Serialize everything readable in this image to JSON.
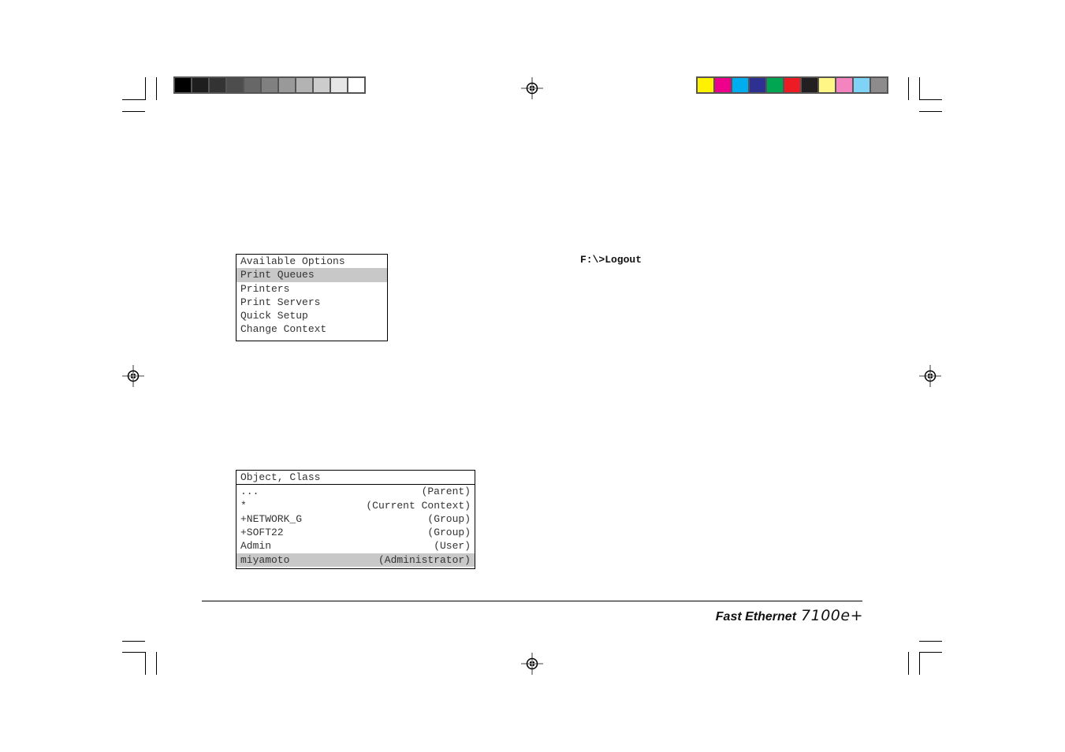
{
  "swatches": {
    "grayscale": [
      "#000000",
      "#1e1e1e",
      "#333333",
      "#4d4d4d",
      "#676767",
      "#808080",
      "#999999",
      "#b3b3b3",
      "#cccccc",
      "#e6e6e6",
      "#ffffff"
    ],
    "color": [
      "#fff200",
      "#ec008c",
      "#00aeef",
      "#2e3192",
      "#00a651",
      "#ed1c24",
      "#231f20",
      "#fff685",
      "#f384c0",
      "#7fd3f7",
      "#8d8b8c"
    ]
  },
  "options_menu": {
    "title": "Available Options",
    "items": [
      {
        "label": "Print Queues",
        "selected": true
      },
      {
        "label": "Printers",
        "selected": false
      },
      {
        "label": "Print Servers",
        "selected": false
      },
      {
        "label": "Quick Setup",
        "selected": false
      },
      {
        "label": "Change Context",
        "selected": false
      }
    ]
  },
  "object_list": {
    "title": "Object, Class",
    "rows": [
      {
        "object": "...",
        "class": "(Parent)",
        "selected": false
      },
      {
        "object": "*",
        "class": "(Current Context)",
        "selected": false
      },
      {
        "object": "+NETWORK_G",
        "class": "(Group)",
        "selected": false
      },
      {
        "object": "+SOFT22",
        "class": "(Group)",
        "selected": false
      },
      {
        "object": "Admin",
        "class": "(User)",
        "selected": false
      },
      {
        "object": "miyamoto",
        "class": "(Administrator)",
        "selected": true
      }
    ]
  },
  "command": "F:\\>Logout",
  "footer": {
    "brand": "Fast Ethernet",
    "model": "7100e+"
  }
}
